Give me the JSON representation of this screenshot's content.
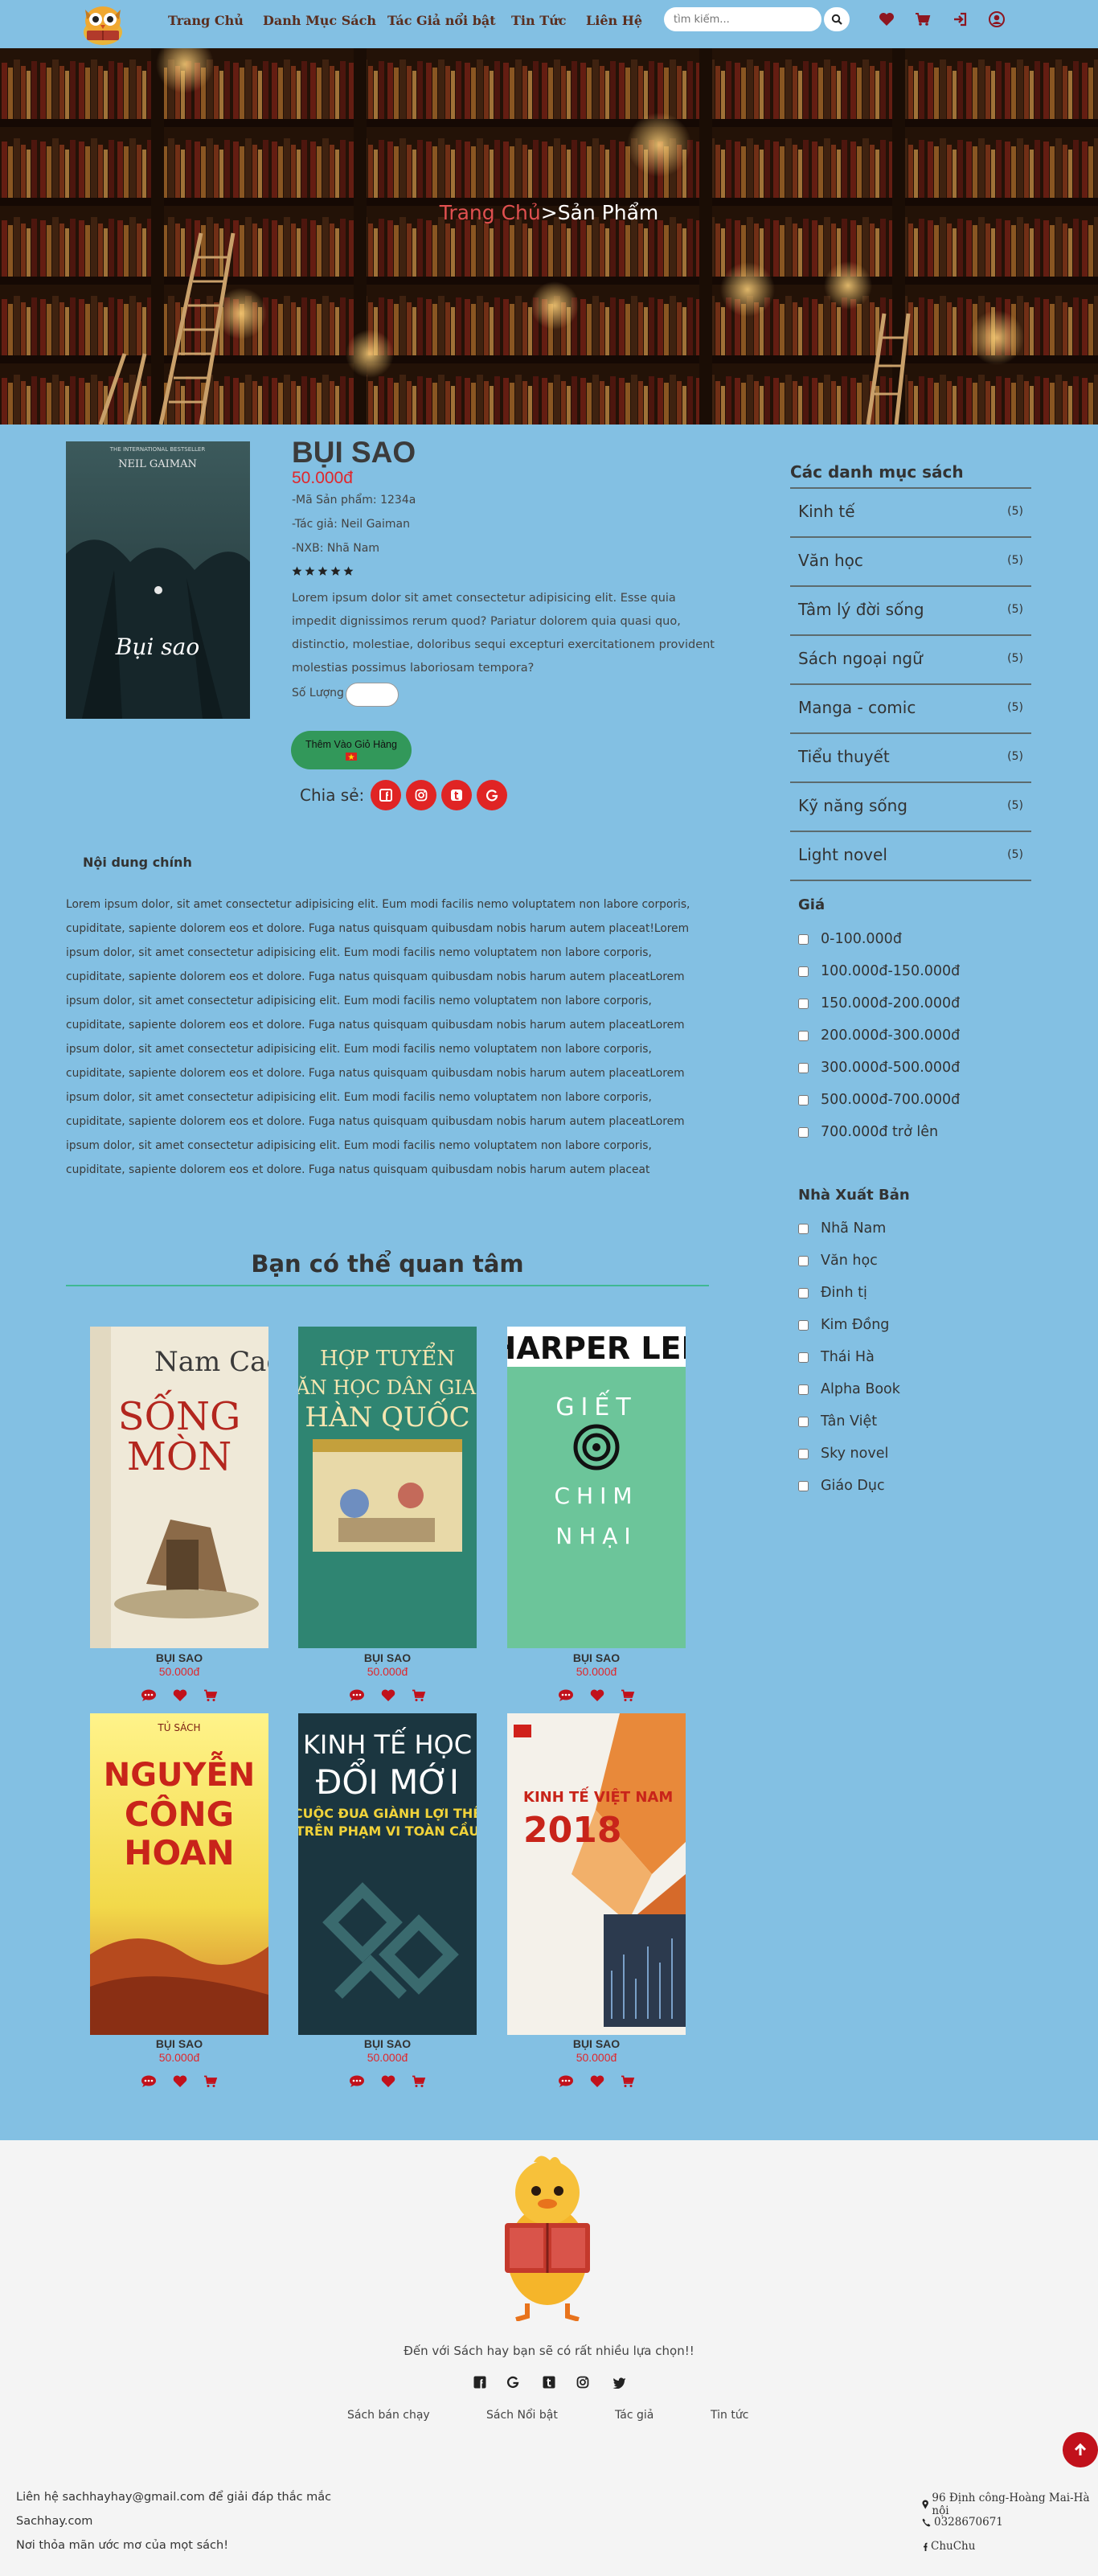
{
  "nav": {
    "items": [
      "Trang Chủ",
      "Danh Mục Sách",
      "Tác Giả nổi bật",
      "Tin Tức",
      "Liên Hệ"
    ],
    "search_placeholder": "tìm kiếm...",
    "icons": [
      "heart-icon",
      "cart-icon",
      "login-icon",
      "user-icon"
    ]
  },
  "breadcrumb": {
    "home": "Trang Chủ",
    "separator": ">",
    "current": "Sản Phẩm"
  },
  "product": {
    "cover_title": "Bụi sao",
    "cover_author": "NEIL GAIMAN",
    "cover_tagline": "THE INTERNATIONAL BESTSELLER",
    "title": "BỤI SAO",
    "price": "50.000đ",
    "code": "-Mã Sản phẩm: 1234a",
    "author": "-Tác giả: Neil Gaiman",
    "publisher": "-NXB: Nhã Nam",
    "rating": 5,
    "description": "Lorem ipsum dolor sit amet consectetur adipisicing elit. Esse quia impedit dignissimos rerum quod? Pariatur dolorem quia quasi quo, distinctio, molestiae, doloribus sequi excepturi exercitationem provident molestias possimus laboriosam tempora?",
    "quantity_label": "Số Lượng",
    "add_to_cart": "Thêm Vào Giỏ Hàng",
    "share_label": "Chia sẻ:"
  },
  "content": {
    "heading": "Nội dung chính",
    "body": "Lorem ipsum dolor, sit amet consectetur adipisicing elit. Eum modi facilis nemo voluptatem non labore corporis, cupiditate, sapiente dolorem eos et dolore. Fuga natus quisquam quibusdam nobis harum autem placeat!Lorem ipsum dolor, sit amet consectetur adipisicing elit. Eum modi facilis nemo voluptatem non labore corporis, cupiditate, sapiente dolorem eos et dolore. Fuga natus quisquam quibusdam nobis harum autem placeatLorem ipsum dolor, sit amet consectetur adipisicing elit. Eum modi facilis nemo voluptatem non labore corporis, cupiditate, sapiente dolorem eos et dolore. Fuga natus quisquam quibusdam nobis harum autem placeatLorem ipsum dolor, sit amet consectetur adipisicing elit. Eum modi facilis nemo voluptatem non labore corporis, cupiditate, sapiente dolorem eos et dolore. Fuga natus quisquam quibusdam nobis harum autem placeatLorem ipsum dolor, sit amet consectetur adipisicing elit. Eum modi facilis nemo voluptatem non labore corporis, cupiditate, sapiente dolorem eos et dolore. Fuga natus quisquam quibusdam nobis harum autem placeatLorem ipsum dolor, sit amet consectetur adipisicing elit. Eum modi facilis nemo voluptatem non labore corporis, cupiditate, sapiente dolorem eos et dolore. Fuga natus quisquam quibusdam nobis harum autem placeat"
  },
  "related": {
    "title": "Bạn có thể quan tâm",
    "items": [
      {
        "name": "BỤI SAO",
        "price": "50.000đ",
        "cover_text": "Nam Cao / SỐNG MÒN"
      },
      {
        "name": "BỤI SAO",
        "price": "50.000đ",
        "cover_text": "HỢP TUYỂN VĂN HỌC DÂN GIAN HÀN QUỐC"
      },
      {
        "name": "BỤI SAO",
        "price": "50.000đ",
        "cover_text": "HARPER LEE / GIẾT CON CHIM NHẠI"
      },
      {
        "name": "BỤI SAO",
        "price": "50.000đ",
        "cover_text": "NGUYỄN CÔNG HOAN"
      },
      {
        "name": "BỤI SAO",
        "price": "50.000đ",
        "cover_text": "KINH TẾ HỌC ĐỔI MỚI"
      },
      {
        "name": "BỤI SAO",
        "price": "50.000đ",
        "cover_text": "KINH TẾ VIỆT NAM 2018"
      }
    ]
  },
  "sidebar": {
    "categories_heading": "Các danh mục sách",
    "categories": [
      {
        "name": "Kinh tế",
        "count": "(5)"
      },
      {
        "name": "Văn học",
        "count": "(5)"
      },
      {
        "name": "Tâm lý đời sống",
        "count": "(5)"
      },
      {
        "name": "Sách ngoại ngữ",
        "count": "(5)"
      },
      {
        "name": "Manga - comic",
        "count": "(5)"
      },
      {
        "name": "Tiểu thuyết",
        "count": "(5)"
      },
      {
        "name": "Kỹ năng sống",
        "count": "(5)"
      },
      {
        "name": "Light novel",
        "count": "(5)"
      }
    ],
    "price_heading": "Giá",
    "prices": [
      "0-100.000đ",
      "100.000đ-150.000đ",
      "150.000đ-200.000đ",
      "200.000đ-300.000đ",
      "300.000đ-500.000đ",
      "500.000đ-700.000đ",
      "700.000đ trở lên"
    ],
    "publisher_heading": "Nhà Xuất Bản",
    "publishers": [
      "Nhã Nam",
      "Văn học",
      "Đinh tị",
      "Kim Đồng",
      "Thái Hà",
      "Alpha Book",
      "Tân Việt",
      "Sky novel",
      "Giáo Dục"
    ]
  },
  "footer": {
    "tagline": "Đến với Sách hay bạn sẽ có rất nhiều lựa chọn!!",
    "links": [
      "Sách bán chạy",
      "Sách Nổi bật",
      "Tác giả",
      "Tin tức"
    ],
    "left": [
      "Liên hệ sachhayhay@gmail.com để giải đáp thắc mắc",
      "Sachhay.com",
      "Nơi thỏa mãn ước mơ của mọt sách!"
    ],
    "address": "96 Định công-Hoàng Mai-Hà nội",
    "phone": "0328670671",
    "facebook": "ChuChu"
  },
  "colors": {
    "background": "#83c0e3",
    "price": "#e0262b",
    "share": "#e02424",
    "cart_button": "#32985a",
    "nav_text": "#5a2e1f"
  }
}
